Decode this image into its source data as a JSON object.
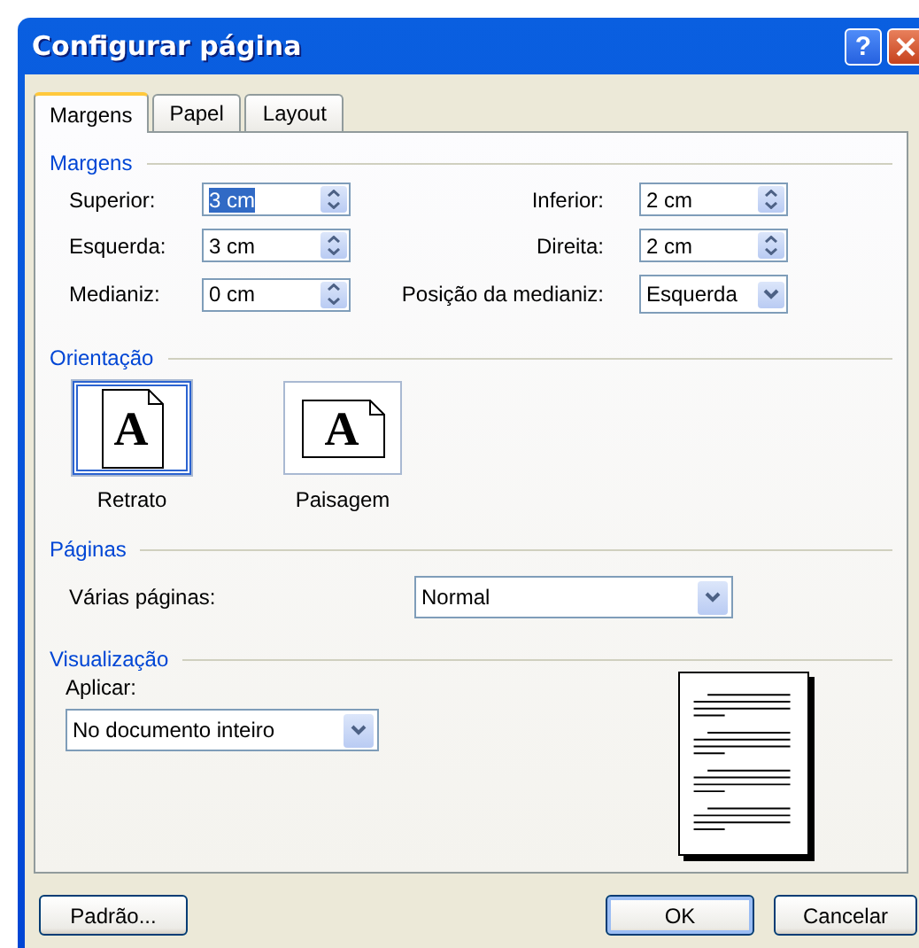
{
  "window": {
    "title": "Configurar página",
    "help": "?"
  },
  "tabs": [
    {
      "label": "Margens",
      "selected": true
    },
    {
      "label": "Papel",
      "selected": false
    },
    {
      "label": "Layout",
      "selected": false
    }
  ],
  "margins": {
    "heading": "Margens",
    "fields": [
      {
        "label": "Superior:",
        "value": "3 cm",
        "kind": "spin",
        "text_selected": true
      },
      {
        "label": "Inferior:",
        "value": "2 cm",
        "kind": "spin",
        "text_selected": false
      },
      {
        "label": "Esquerda:",
        "value": "3 cm",
        "kind": "spin",
        "text_selected": false
      },
      {
        "label": "Direita:",
        "value": "2 cm",
        "kind": "spin",
        "text_selected": false
      },
      {
        "label": "Medianiz:",
        "value": "0 cm",
        "kind": "spin",
        "text_selected": false
      },
      {
        "label": "Posição da medianiz:",
        "value": "Esquerda",
        "kind": "combo",
        "text_selected": false
      }
    ]
  },
  "orientation": {
    "heading": "Orientação",
    "options": [
      {
        "label": "Retrato",
        "glyph": "A",
        "kind": "portrait",
        "selected": true
      },
      {
        "label": "Paisagem",
        "glyph": "A",
        "kind": "landscape",
        "selected": false
      }
    ]
  },
  "pages": {
    "heading": "Páginas",
    "label": "Várias páginas:",
    "value": "Normal"
  },
  "preview": {
    "heading": "Visualização",
    "apply_label": "Aplicar:",
    "apply_value": "No documento inteiro"
  },
  "buttons": [
    {
      "label": "Padrão...",
      "default": false
    },
    {
      "label": "OK",
      "default": true
    },
    {
      "label": "Cancelar",
      "default": false
    }
  ]
}
